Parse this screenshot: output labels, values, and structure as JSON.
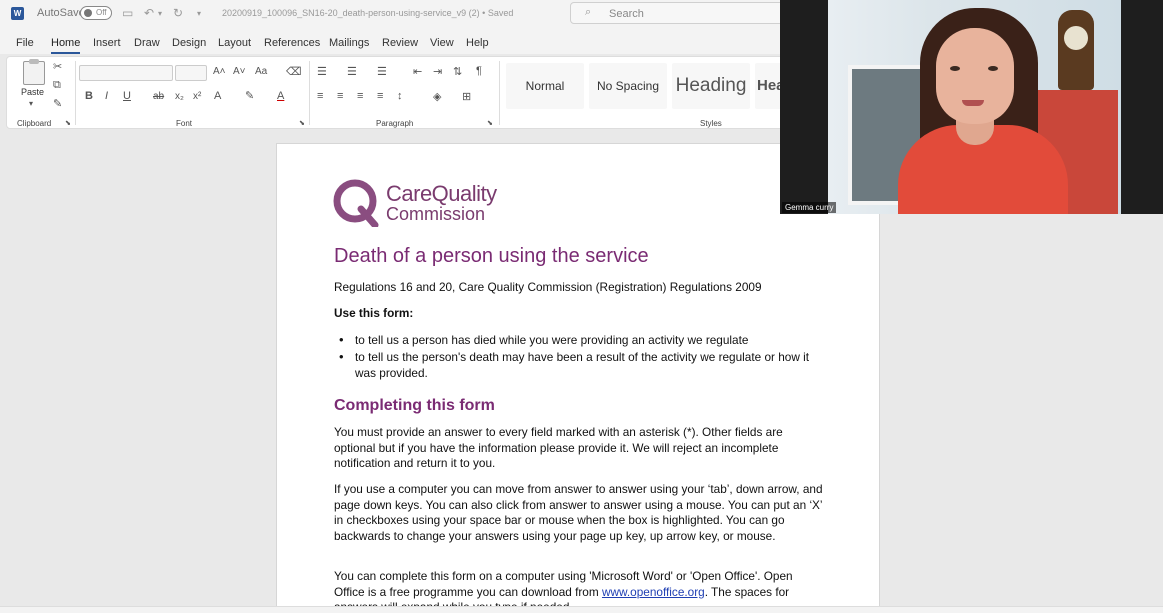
{
  "titlebar": {
    "app_icon": "W",
    "autosave_label": "AutoSave",
    "autosave_state": "Off",
    "filename": "20200919_100096_SN16-20_death-person-using-service_v9 (2) • Saved",
    "search_placeholder": "Search"
  },
  "menu": {
    "items": [
      "File",
      "Home",
      "Insert",
      "Draw",
      "Design",
      "Layout",
      "References",
      "Mailings",
      "Review",
      "View",
      "Help"
    ],
    "active": "Home"
  },
  "ribbon": {
    "paste_label": "Paste",
    "groups": {
      "clipboard": "Clipboard",
      "font": "Font",
      "paragraph": "Paragraph",
      "styles": "Styles"
    },
    "styles": [
      "Normal",
      "No Spacing",
      "Heading",
      "Hea"
    ]
  },
  "document": {
    "logo_line1": "CareQuality",
    "logo_line2": "Commission",
    "title": "Death of a person using the service",
    "regulations": "Regulations 16 and 20, Care Quality Commission (Registration) Regulations 2009",
    "use_form_label": "Use this form:",
    "bullets": [
      "to tell us a person has died while you were providing an activity we regulate",
      "to tell us the person's death may have been a result of the activity we regulate or how it was provided."
    ],
    "section_heading": "Completing this form",
    "para1": "You must provide an answer to every field marked with an asterisk (*). Other fields are optional but if you have the information please provide it. We will reject an incomplete notification and return it to you.",
    "para2": "If you use a computer you can move from answer to answer using your ‘tab’, down arrow, and page down keys. You can also click from answer to answer using a mouse. You can put an ‘X’ in checkboxes using your space bar or mouse when the box is highlighted. You can go backwards to change your answers using your page up key, up arrow key, or mouse.",
    "para3_before": "You can complete this form on a computer using 'Microsoft Word' or 'Open Office'. Open Office is a free programme you can download from ",
    "para3_link": "www.openoffice.org",
    "para3_after": ". The spaces for answers will expand while you type if needed."
  },
  "video": {
    "participant_name": "Gemma curry"
  },
  "colors": {
    "accent": "#2b579a",
    "cqc_purple": "#7a2b73",
    "link": "#1f3fb3"
  }
}
